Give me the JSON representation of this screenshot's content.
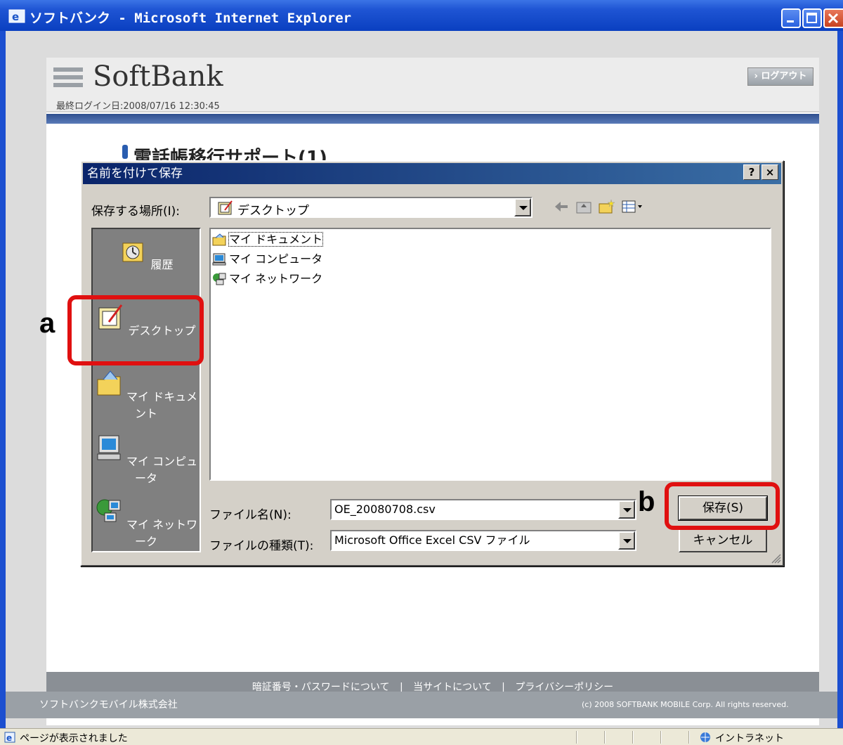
{
  "window": {
    "title": "ソフトバンク - Microsoft Internet Explorer"
  },
  "page": {
    "logo_text": "SoftBank",
    "logout_label": "› ログアウト",
    "last_login": "最終ログイン日:2008/07/16 12:30:45",
    "heading": "電話帳移行サポート(1)",
    "footer_links": [
      "暗証番号・パスワードについて",
      "当サイトについて",
      "プライバシーポリシー"
    ],
    "footer_sep": "|",
    "company": "ソフトバンクモバイル株式会社",
    "copyright": "(c) 2008 SOFTBANK MOBILE Corp. All rights reserved."
  },
  "dialog": {
    "title": "名前を付けて保存",
    "help_label": "?",
    "close_label": "×",
    "location_label": "保存する場所(I):",
    "location_value": "デスクトップ",
    "places": [
      {
        "label": "履歴",
        "icon": "history-icon"
      },
      {
        "label": "デスクトップ",
        "icon": "desktop-icon"
      },
      {
        "label": "マイ ドキュメント",
        "icon": "my-documents-icon"
      },
      {
        "label": "マイ コンピュータ",
        "icon": "my-computer-icon"
      },
      {
        "label": "マイ ネットワーク",
        "icon": "my-network-icon"
      }
    ],
    "files": [
      {
        "label": "マイ ドキュメント",
        "icon": "my-documents-icon"
      },
      {
        "label": "マイ コンピュータ",
        "icon": "my-computer-icon"
      },
      {
        "label": "マイ ネットワーク",
        "icon": "my-network-icon"
      }
    ],
    "filename_label": "ファイル名(N):",
    "filename_value": "OE_20080708.csv",
    "filetype_label": "ファイルの種類(T):",
    "filetype_value": "Microsoft Office Excel CSV ファイル",
    "save_label": "保存(S)",
    "cancel_label": "キャンセル"
  },
  "annotations": {
    "a": "a",
    "b": "b",
    "highlight_color": "#e01010"
  },
  "statusbar": {
    "text": "ページが表示されました",
    "zone": "イントラネット"
  }
}
